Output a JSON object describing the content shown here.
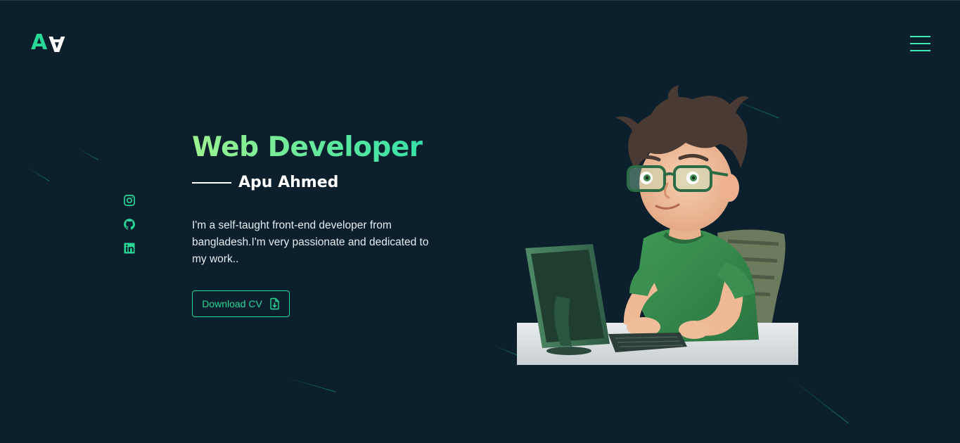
{
  "brand": {
    "logo_left": "A",
    "logo_right": "A"
  },
  "nav": {
    "menu_icon": "hamburger-icon"
  },
  "social": [
    {
      "name": "instagram",
      "icon": "instagram-icon"
    },
    {
      "name": "github",
      "icon": "github-icon"
    },
    {
      "name": "linkedin",
      "icon": "linkedin-icon"
    }
  ],
  "hero": {
    "role": "Web Developer",
    "name": "Apu Ahmed",
    "bio": "I'm a self-taught front-end developer from bangladesh.I'm very passionate and dedicated to my work..",
    "cta_label": "Download CV",
    "cta_icon": "file-download-icon"
  },
  "colors": {
    "background": "#0b1f2c",
    "accent": "#27d896",
    "gradient_start": "#9cf38f",
    "gradient_end": "#35e0a8",
    "text": "#ffffff"
  }
}
